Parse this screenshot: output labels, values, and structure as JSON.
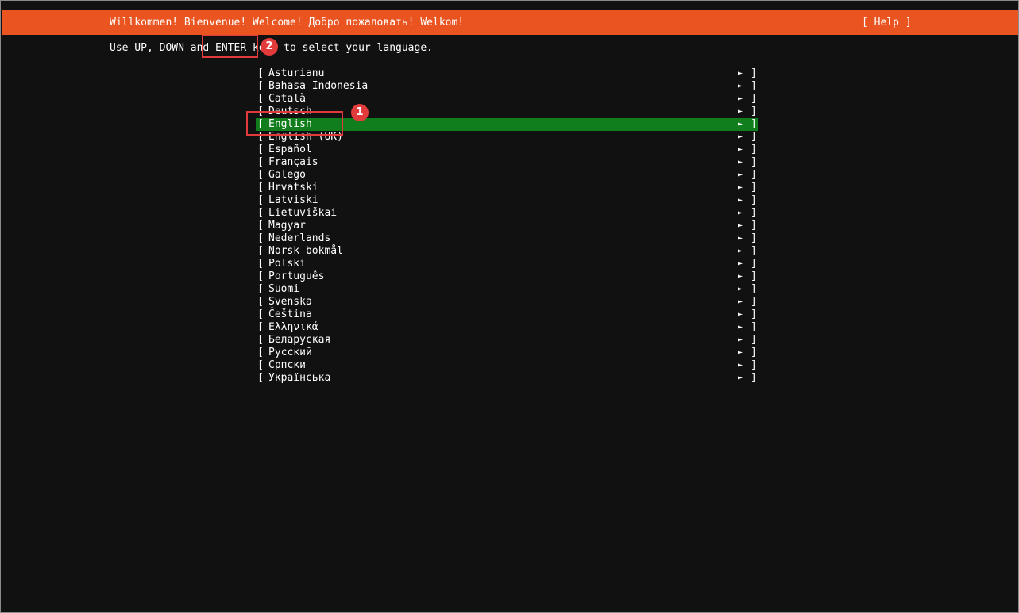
{
  "header": {
    "title": "Willkommen! Bienvenue! Welcome! Добро пожаловать! Welkom!",
    "help_label": "[ Help ]",
    "bg_color": "#e95420"
  },
  "instruction": "Use UP, DOWN and ENTER keys to select your language.",
  "languages": [
    {
      "label": "Asturianu"
    },
    {
      "label": "Bahasa Indonesia"
    },
    {
      "label": "Català"
    },
    {
      "label": "Deutsch"
    },
    {
      "label": "English",
      "selected": true
    },
    {
      "label": "English (UK)"
    },
    {
      "label": "Español"
    },
    {
      "label": "Français"
    },
    {
      "label": "Galego"
    },
    {
      "label": "Hrvatski"
    },
    {
      "label": "Latviski"
    },
    {
      "label": "Lietuviškai"
    },
    {
      "label": "Magyar"
    },
    {
      "label": "Nederlands"
    },
    {
      "label": "Norsk bokmål"
    },
    {
      "label": "Polski"
    },
    {
      "label": "Português"
    },
    {
      "label": "Suomi"
    },
    {
      "label": "Svenska"
    },
    {
      "label": "Čeština"
    },
    {
      "label": "Ελληνικά"
    },
    {
      "label": "Беларуская"
    },
    {
      "label": "Русский"
    },
    {
      "label": "Српски"
    },
    {
      "label": "Українська"
    }
  ],
  "item_bracket_left": "[",
  "item_bracket_right": "]",
  "item_arrow_icon": "right-triangle-icon",
  "item_arrow_glyph": "►",
  "selected_color": "#107e1d",
  "annotations": [
    {
      "number": "1"
    },
    {
      "number": "2"
    }
  ]
}
